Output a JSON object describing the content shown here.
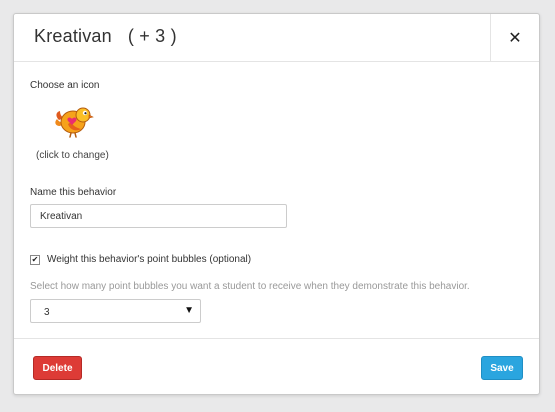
{
  "header": {
    "title": "Kreativan",
    "points": "( + 3 )",
    "close_glyph": "✕"
  },
  "icon_section": {
    "label": "Choose an icon",
    "hint": "(click to change)",
    "icon_name": "colorful-bird-icon"
  },
  "name_field": {
    "label": "Name this behavior",
    "value": "Kreativan"
  },
  "weight": {
    "checked": true,
    "check_glyph": "✔",
    "label": "Weight this behavior's point bubbles (optional)",
    "helper": "Select how many point bubbles you want a student to receive when they demonstrate this behavior.",
    "selected": "3",
    "caret": "▼"
  },
  "footer": {
    "delete_label": "Delete",
    "save_label": "Save"
  },
  "colors": {
    "delete": "#dd3b36",
    "save": "#2aa5df",
    "background": "#e9e9ea"
  }
}
